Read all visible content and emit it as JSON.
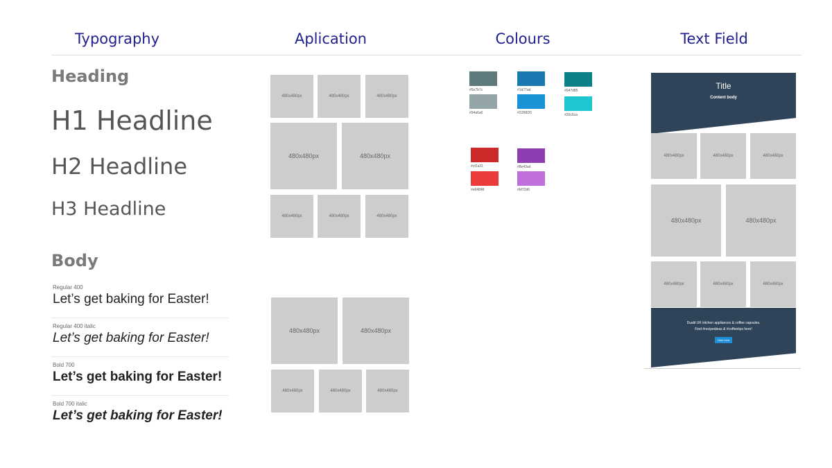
{
  "columns": {
    "typography": "Typography",
    "application": "Aplication",
    "colours": "Colours",
    "text_field": "Text Field"
  },
  "typography": {
    "heading_label": "Heading",
    "h1": "H1 Headline",
    "h2": "H2 Headline",
    "h3": "H3 Headline",
    "body_label": "Body",
    "samples": [
      {
        "label": "Regular 400",
        "text": "Let’s get baking for Easter!"
      },
      {
        "label": "Regular 400 italic",
        "text": "Let’s get baking for Easter!"
      },
      {
        "label": "Bold 700",
        "text": "Let’s get baking for Easter!"
      },
      {
        "label": "Bold 700 italic",
        "text": "Let’s get baking for Easter!"
      }
    ]
  },
  "tile_label": "480x480px",
  "colours": [
    {
      "hex": "#5e7a7c",
      "label": "#5e7b7c"
    },
    {
      "hex": "#1a78b0",
      "label": "#1d77ad"
    },
    {
      "hex": "#0c8089",
      "label": "#047d85"
    },
    {
      "hex": "#93a5a6",
      "label": "#94a6a6"
    },
    {
      "hex": "#1a93d6",
      "label": "#22B8D5"
    },
    {
      "hex": "#20c6cf",
      "label": "#20c6ca"
    },
    {
      "hex": "#cc2a2a",
      "label": "#cf2a31"
    },
    {
      "hex": "#8e3eb3",
      "label": "#8e43ad"
    },
    {
      "hex": "#ec3b3b",
      "label": "#e84848"
    },
    {
      "hex": "#c070dd",
      "label": "#bf72d6"
    }
  ],
  "text_field": {
    "title": "Title",
    "subtitle": "Content body",
    "footer_line1": "Dualit UK kitchen appliances & coffee capsules.",
    "footer_line2": "Find #recipeideas & #coffeetips here!",
    "button": "Click here"
  }
}
